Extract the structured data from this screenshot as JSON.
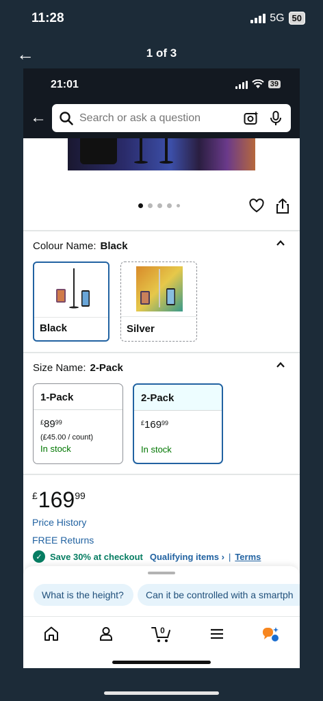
{
  "outer": {
    "time": "11:28",
    "network": "5G",
    "battery": "50",
    "counter": "1 of 3"
  },
  "inner_status": {
    "time": "21:01",
    "battery": "39"
  },
  "search": {
    "placeholder": "Search or ask a question"
  },
  "gallery": {
    "dot_count": 5,
    "active_dot": 0
  },
  "colour": {
    "label": "Colour Name:",
    "value": "Black",
    "options": [
      {
        "name": "Black",
        "selected": true
      },
      {
        "name": "Silver",
        "selected": false
      }
    ]
  },
  "size": {
    "label": "Size Name:",
    "value": "2-Pack",
    "options": [
      {
        "name": "1-Pack",
        "currency": "£",
        "whole": "89",
        "fraction": "99",
        "unit_price": "(£45.00 / count)",
        "stock": "In stock",
        "selected": false
      },
      {
        "name": "2-Pack",
        "currency": "£",
        "whole": "169",
        "fraction": "99",
        "unit_price": "",
        "stock": "In stock",
        "selected": true
      }
    ]
  },
  "price": {
    "currency": "£",
    "whole": "169",
    "fraction": "99",
    "history_link": "Price History",
    "returns_link": "FREE Returns"
  },
  "promo": {
    "check": "✓",
    "text": "Save 30% at checkout",
    "qualifying": "Qualifying items ›",
    "separator": "|",
    "terms": "Terms"
  },
  "questions": [
    "What is the height?",
    "Can it be controlled with a smartph"
  ],
  "colors": {
    "outer_bg": "#1c2b38",
    "amazon_header": "#131921",
    "link_blue": "#2162a1",
    "in_stock_green": "#007600",
    "promo_green": "#067d62",
    "chip_bg": "#e6f3fb"
  },
  "tabs": [
    "home-icon",
    "account-icon",
    "cart-icon",
    "menu-icon",
    "rufus-icon"
  ],
  "cart_count": "0"
}
